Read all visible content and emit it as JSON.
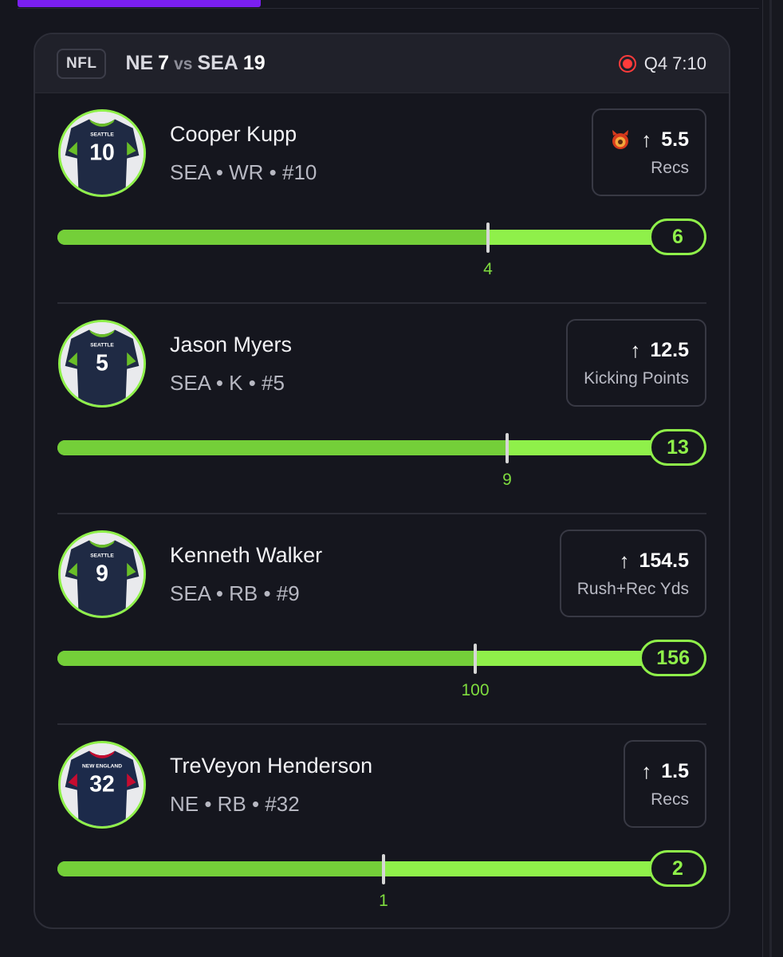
{
  "game": {
    "league": "NFL",
    "home_team": "NE",
    "home_score": "7",
    "vs": "vs",
    "away_team": "SEA",
    "away_score": "19",
    "status": "Q4 7:10"
  },
  "players": [
    {
      "name": "Cooper Kupp",
      "meta": "SEA • WR • #10",
      "jersey_team": "SEATTLE",
      "jersey_number": "10",
      "line": "5.5",
      "stat": "Recs",
      "direction": "up",
      "has_devil_icon": true,
      "current": "6",
      "marker_label": "4",
      "progress": 0.66
    },
    {
      "name": "Jason Myers",
      "meta": "SEA • K • #5",
      "jersey_team": "SEATTLE",
      "jersey_number": "5",
      "line": "12.5",
      "stat": "Kicking Points",
      "direction": "up",
      "has_devil_icon": false,
      "current": "13",
      "marker_label": "9",
      "progress": 0.69
    },
    {
      "name": "Kenneth Walker",
      "meta": "SEA • RB • #9",
      "jersey_team": "SEATTLE",
      "jersey_number": "9",
      "line": "154.5",
      "stat": "Rush+Rec Yds",
      "direction": "up",
      "has_devil_icon": false,
      "current": "156",
      "marker_label": "100",
      "progress": 0.64
    },
    {
      "name": "TreVeyon Henderson",
      "meta": "NE • RB • #32",
      "jersey_team": "NEW ENGLAND",
      "jersey_number": "32",
      "line": "1.5",
      "stat": "Recs",
      "direction": "up",
      "has_devil_icon": false,
      "current": "2",
      "marker_label": "1",
      "progress": 0.5
    }
  ],
  "colors": {
    "accent": "#8ff04a",
    "accent_dark": "#74cf39",
    "live": "#ff3b3b",
    "brand": "#7a1ff0"
  }
}
